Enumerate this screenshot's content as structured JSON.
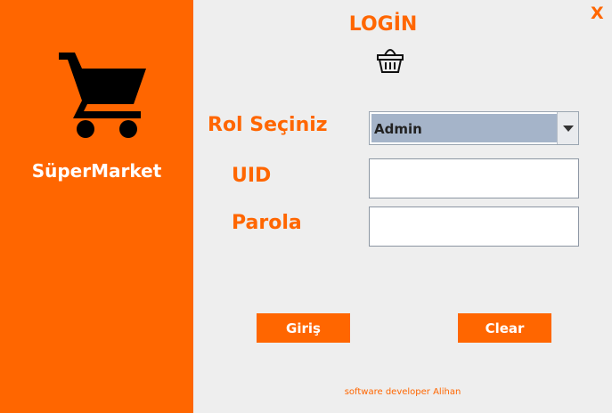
{
  "brand": {
    "name": "SüperMarket",
    "logo_icon": "shopping-cart-icon"
  },
  "window": {
    "close_label": "X"
  },
  "header": {
    "title": "LOGİN",
    "icon": "basket-icon"
  },
  "form": {
    "role_label": "Rol Seçiniz",
    "role_selected": "Admin",
    "uid_label": "UID",
    "uid_value": "",
    "password_label": "Parola",
    "password_value": ""
  },
  "buttons": {
    "login_label": "Giriş",
    "clear_label": "Clear"
  },
  "footer": {
    "credit": "software developer Alihan"
  },
  "colors": {
    "accent": "#ff6600",
    "background": "#eeeeee",
    "select_highlight": "#a5b4c9"
  }
}
